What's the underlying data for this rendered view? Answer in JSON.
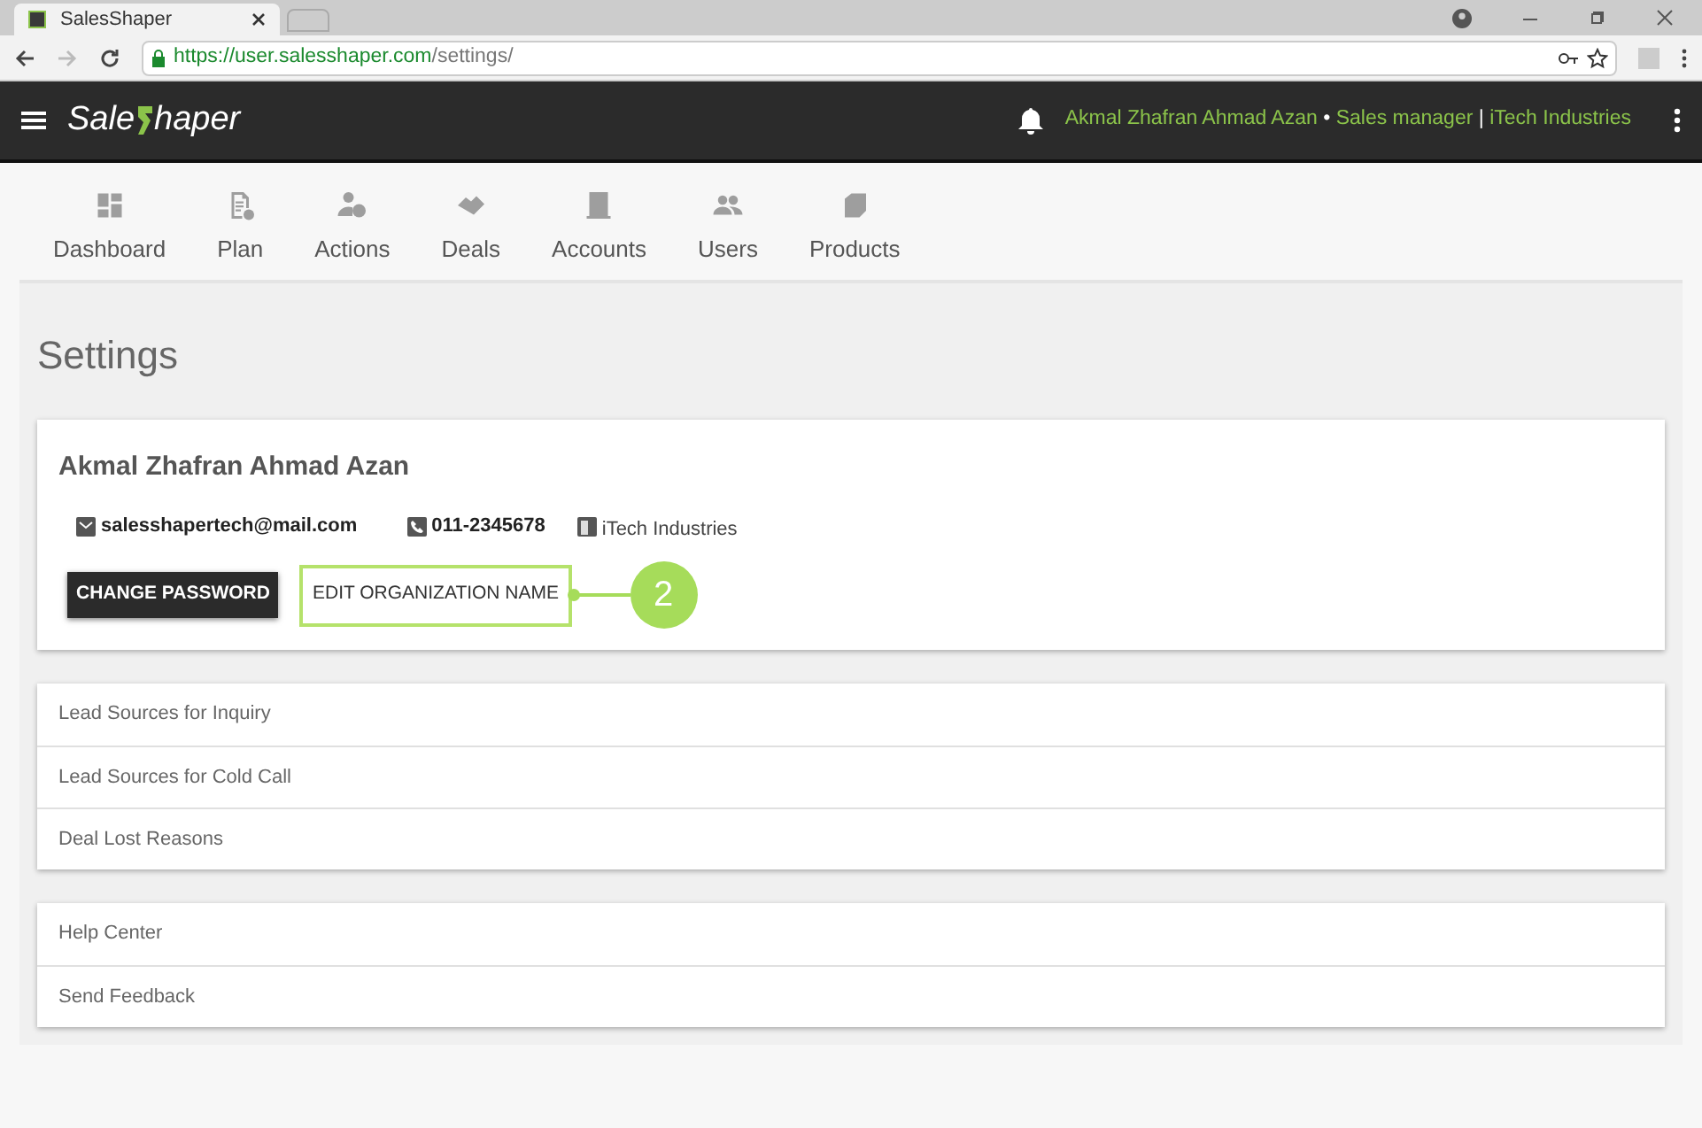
{
  "browser": {
    "tab_title": "SalesShaper",
    "url_host": "https://user.salesshaper.com",
    "url_path": "/settings/"
  },
  "header": {
    "brand_before": "Sale",
    "brand_after": "haper",
    "user_name": "Akmal Zhafran Ahmad Azan",
    "dot": "•",
    "role": "Sales manager",
    "divider": "|",
    "organization": "iTech Industries"
  },
  "nav": [
    {
      "label": "Dashboard",
      "kind": "dashboard"
    },
    {
      "label": "Plan",
      "kind": "plan"
    },
    {
      "label": "Actions",
      "kind": "actions"
    },
    {
      "label": "Deals",
      "kind": "deals"
    },
    {
      "label": "Accounts",
      "kind": "accounts"
    },
    {
      "label": "Users",
      "kind": "users"
    },
    {
      "label": "Products",
      "kind": "products"
    }
  ],
  "page_title": "Settings",
  "profile": {
    "name": "Akmal Zhafran Ahmad Azan",
    "email": "salesshapertech@mail.com",
    "phone": "011-2345678",
    "organization": "iTech Industries",
    "buttons": [
      {
        "label": "CHANGE PASSWORD",
        "kind": "dark"
      },
      {
        "label": "EDIT ORGANIZATION NAME",
        "kind": "highlighted"
      }
    ],
    "callout": "2"
  },
  "groups": [
    {
      "items": [
        "Lead Sources for Inquiry",
        "Lead Sources for Cold Call",
        "Deal Lost Reasons"
      ]
    },
    {
      "items": [
        "Help Center",
        "Send Feedback"
      ]
    }
  ]
}
